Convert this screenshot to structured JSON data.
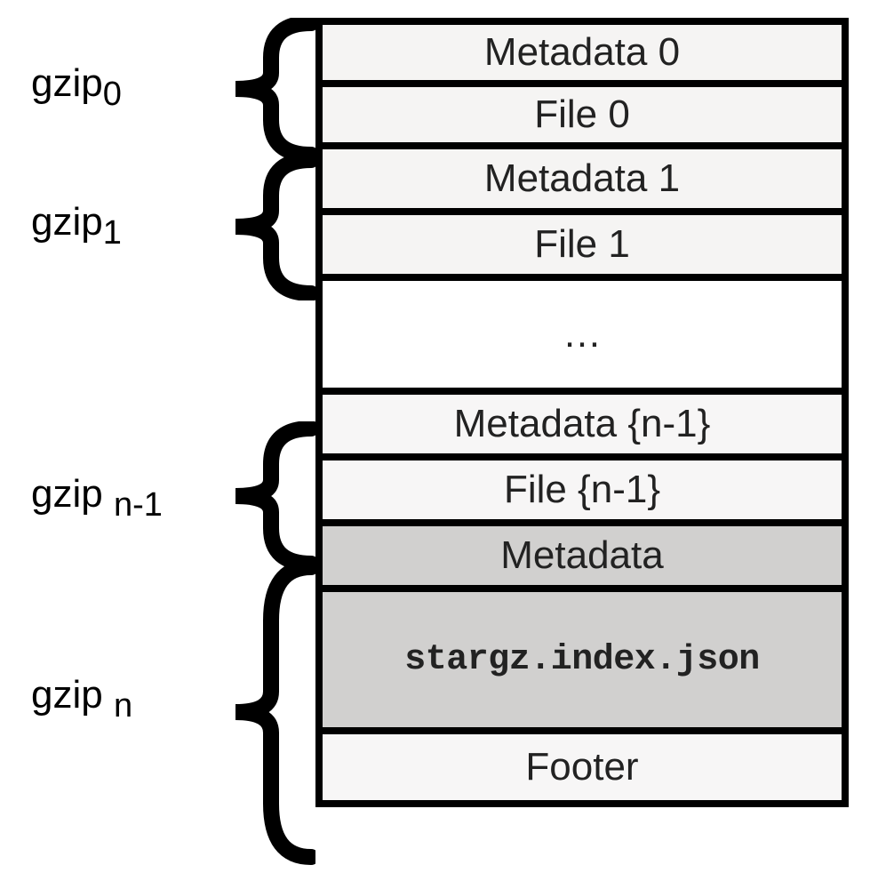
{
  "labels": {
    "g0": {
      "prefix": "gzip",
      "sub": "0"
    },
    "g1": {
      "prefix": "gzip",
      "sub": "1"
    },
    "gnm1": {
      "prefix": "gzip",
      "sub": "n-1"
    },
    "gn": {
      "prefix": "gzip",
      "sub": "n"
    }
  },
  "cells": {
    "meta0": "Metadata 0",
    "file0": "File 0",
    "meta1": "Metadata 1",
    "file1": "File 1",
    "ellipsis": "…",
    "metanm1": "Metadata {n-1}",
    "filenm1": "File {n-1}",
    "meta": "Metadata",
    "index": "stargz.index.json",
    "footer": "Footer"
  }
}
